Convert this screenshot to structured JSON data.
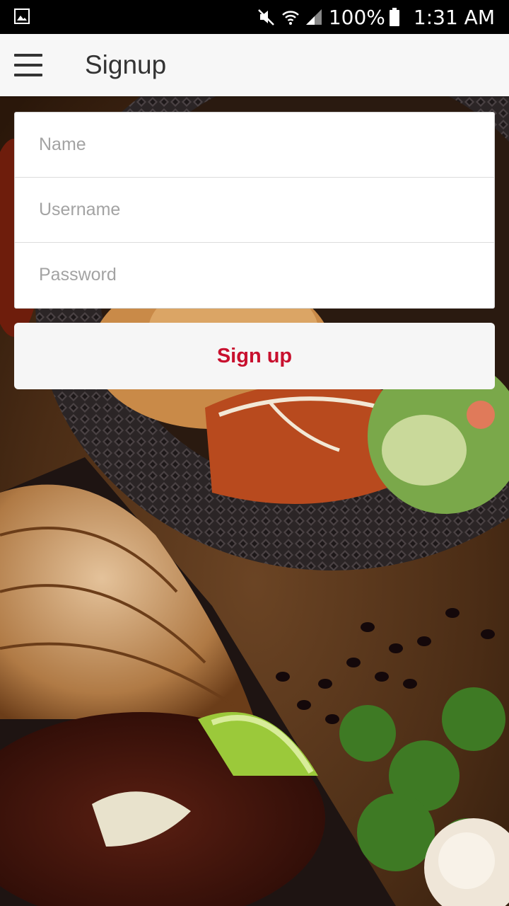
{
  "status_bar": {
    "battery_percent": "100%",
    "time": "1:31 AM",
    "icons": [
      "image-icon",
      "mute-icon",
      "wifi-icon",
      "signal-icon",
      "battery-icon"
    ]
  },
  "app_bar": {
    "title": "Signup",
    "menu_icon": "hamburger-menu-icon"
  },
  "form": {
    "fields": [
      {
        "name": "name",
        "placeholder": "Name",
        "value": ""
      },
      {
        "name": "username",
        "placeholder": "Username",
        "value": ""
      },
      {
        "name": "password",
        "placeholder": "Password",
        "value": ""
      }
    ],
    "submit_label": "Sign up"
  },
  "colors": {
    "accent": "#c8102e",
    "app_bar_bg": "#f7f7f7",
    "status_bar_bg": "#000000"
  },
  "background": {
    "icon": "food-photo-background"
  }
}
